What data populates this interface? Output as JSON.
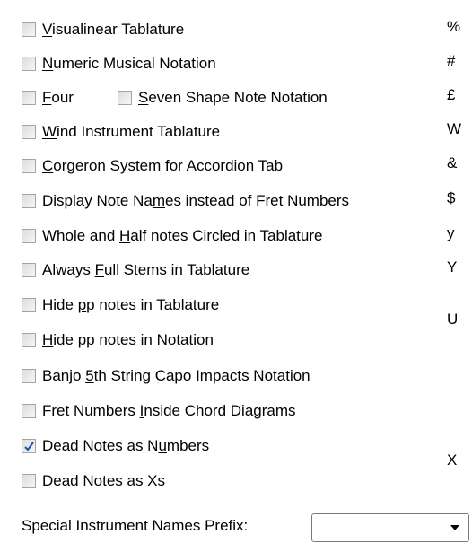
{
  "options": [
    {
      "pre": "",
      "u": "V",
      "post": "isualinear Tablature",
      "checked": false,
      "shortcut": "%"
    },
    {
      "pre": "",
      "u": "N",
      "post": "umeric Musical Notation",
      "checked": false,
      "shortcut": "#"
    },
    {
      "pre": "",
      "u": "F",
      "post": "our",
      "checked": false,
      "shortcut": "£"
    },
    {
      "pre": "",
      "u": "S",
      "post": "even Shape Note Notation",
      "checked": false,
      "shortcut": ""
    },
    {
      "pre": "",
      "u": "W",
      "post": "ind Instrument Tablature",
      "checked": false,
      "shortcut": "W"
    },
    {
      "pre": "",
      "u": "C",
      "post": "orgeron System for Accordion Tab",
      "checked": false,
      "shortcut": "&"
    },
    {
      "pre": "Display Note Na",
      "u": "m",
      "post": "es instead of Fret Numbers",
      "checked": false,
      "shortcut": "$"
    },
    {
      "pre": "Whole and ",
      "u": "H",
      "post": "alf notes Circled in Tablature",
      "checked": false,
      "shortcut": "y"
    },
    {
      "pre": "Always ",
      "u": "F",
      "post": "ull Stems in Tablature",
      "checked": false,
      "shortcut": "Y"
    },
    {
      "pre": "Hide ",
      "u": "p",
      "post": "p notes in Tablature",
      "checked": false,
      "shortcut": "U"
    },
    {
      "pre": "",
      "u": "H",
      "post": "ide pp notes in Notation",
      "checked": false,
      "shortcut": ""
    },
    {
      "pre": "Banjo ",
      "u": "5",
      "post": "th String Capo Impacts Notation",
      "checked": false,
      "shortcut": ""
    },
    {
      "pre": "Fret Numbers ",
      "u": "I",
      "post": "nside Chord Diagrams",
      "checked": false,
      "shortcut": ""
    },
    {
      "pre": "Dead Notes as N",
      "u": "u",
      "post": "mbers",
      "checked": true,
      "shortcut": "X"
    },
    {
      "pre": "Dead Notes as Xs",
      "u": "",
      "post": "",
      "checked": false,
      "shortcut": ""
    }
  ],
  "prefix": {
    "label": "Special Instrument Names Prefix:",
    "value": ""
  },
  "colors": {
    "checkmark": "#1e4fb4"
  }
}
